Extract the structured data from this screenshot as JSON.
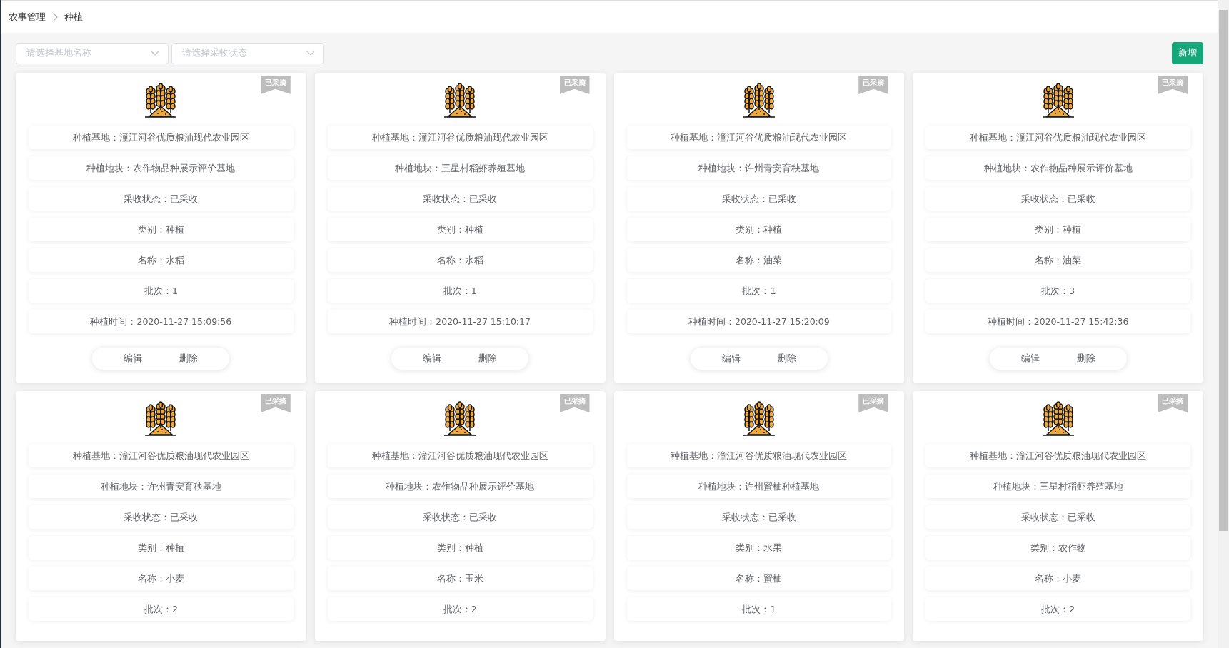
{
  "breadcrumb": [
    "农事管理",
    "种植"
  ],
  "filters": [
    {
      "placeholder": "请选择基地名称"
    },
    {
      "placeholder": "请选择采收状态"
    }
  ],
  "add_button": "新增",
  "cards": [
    {
      "badge": "已采摘",
      "fields": [
        "种植基地：潼江河谷优质粮油现代农业园区",
        "种植地块：农作物品种展示评价基地",
        "采收状态：已采收",
        "类别：种植",
        "名称：水稻",
        "批次：1",
        "种植时间：2020-11-27 15:09:56"
      ],
      "actions": [
        "编辑",
        "删除"
      ]
    },
    {
      "badge": "已采摘",
      "fields": [
        "种植基地：潼江河谷优质粮油现代农业园区",
        "种植地块：三星村稻虾养殖基地",
        "采收状态：已采收",
        "类别：种植",
        "名称：水稻",
        "批次：1",
        "种植时间：2020-11-27 15:10:17"
      ],
      "actions": [
        "编辑",
        "删除"
      ]
    },
    {
      "badge": "已采摘",
      "fields": [
        "种植基地：潼江河谷优质粮油现代农业园区",
        "种植地块：许州青安育秧基地",
        "采收状态：已采收",
        "类别：种植",
        "名称：油菜",
        "批次：1",
        "种植时间：2020-11-27 15:20:09"
      ],
      "actions": [
        "编辑",
        "删除"
      ]
    },
    {
      "badge": "已采摘",
      "fields": [
        "种植基地：潼江河谷优质粮油现代农业园区",
        "种植地块：农作物品种展示评价基地",
        "采收状态：已采收",
        "类别：种植",
        "名称：油菜",
        "批次：3",
        "种植时间：2020-11-27 15:42:36"
      ],
      "actions": [
        "编辑",
        "删除"
      ]
    },
    {
      "badge": "已采摘",
      "fields": [
        "种植基地：潼江河谷优质粮油现代农业园区",
        "种植地块：许州青安育秧基地",
        "采收状态：已采收",
        "类别：种植",
        "名称：小麦",
        "批次：2"
      ]
    },
    {
      "badge": "已采摘",
      "fields": [
        "种植基地：潼江河谷优质粮油现代农业园区",
        "种植地块：农作物品种展示评价基地",
        "采收状态：已采收",
        "类别：种植",
        "名称：玉米",
        "批次：2"
      ]
    },
    {
      "badge": "已采摘",
      "fields": [
        "种植基地：潼江河谷优质粮油现代农业园区",
        "种植地块：许州蜜柚种植基地",
        "采收状态：已采收",
        "类别：水果",
        "名称：蜜柚",
        "批次：1"
      ]
    },
    {
      "badge": "已采摘",
      "fields": [
        "种植基地：潼江河谷优质粮油现代农业园区",
        "种植地块：三星村稻虾养殖基地",
        "采收状态：已采收",
        "类别：农作物",
        "名称：小麦",
        "批次：2"
      ]
    }
  ]
}
